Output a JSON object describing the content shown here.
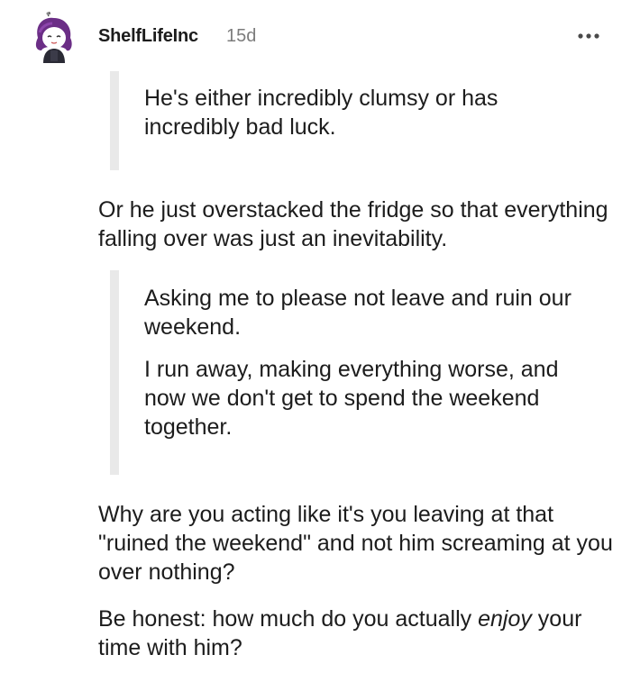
{
  "comment": {
    "author": "ShelfLifeInc",
    "time_ago": "15d",
    "icons": {
      "avatar": "avatar-icon",
      "more": "more-options-icon"
    },
    "quote_1": "He's either incredibly clumsy or has incredibly bad luck.",
    "para_1": "Or he just overstacked the fridge so that everything falling over was just an inevitability.",
    "quote_2a": "Asking me to please not leave and ruin our weekend.",
    "quote_2b": "I run away, making everything worse, and now we don't get to spend the weekend together.",
    "para_2": "Why are you acting like it's you leaving at that \"ruined the weekend\" and not him screaming at you over nothing?",
    "para_3_start": "Be honest: how much do you actually ",
    "para_3_emphasis": "enjoy",
    "para_3_end": " your time with him?"
  }
}
